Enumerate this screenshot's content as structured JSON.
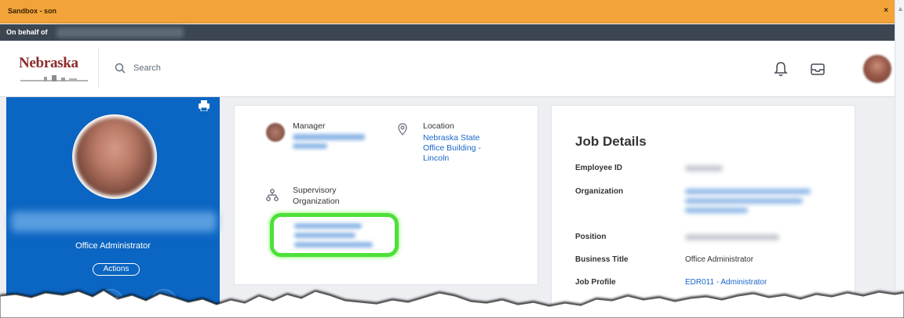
{
  "window": {
    "sandbox_title": "Sandbox - son",
    "close_symbol": "×",
    "on_behalf_label": "On behalf of"
  },
  "header": {
    "logo_text": "Nebraska",
    "search_placeholder": "Search",
    "icons": [
      "bell-icon",
      "inbox-icon"
    ]
  },
  "profile": {
    "title": "Office Administrator",
    "actions_label": "Actions",
    "action_icons": [
      "mail-icon",
      "org-chart-icon"
    ]
  },
  "overview": {
    "manager_label": "Manager",
    "location_label": "Location",
    "location_value": "Nebraska State Office Building - Lincoln",
    "location_lines": [
      "Nebraska State",
      "Office Building -",
      "Lincoln"
    ],
    "supervisory_label_line1": "Supervisory",
    "supervisory_label_line2": "Organization"
  },
  "job_details": {
    "title": "Job Details",
    "fields": [
      {
        "label": "Employee ID",
        "value": ""
      },
      {
        "label": "Organization",
        "value": ""
      },
      {
        "label": "Position",
        "value": ""
      },
      {
        "label": "Business Title",
        "value": "Office Administrator"
      },
      {
        "label": "Job Profile",
        "value": "EDR011 - Administrator"
      }
    ]
  },
  "colors": {
    "sandbox_bar": "#f2a33a",
    "behalf_bar": "#3b4652",
    "profile_panel": "#0b65c2",
    "link": "#1a66c9",
    "highlight": "#4de03a"
  }
}
